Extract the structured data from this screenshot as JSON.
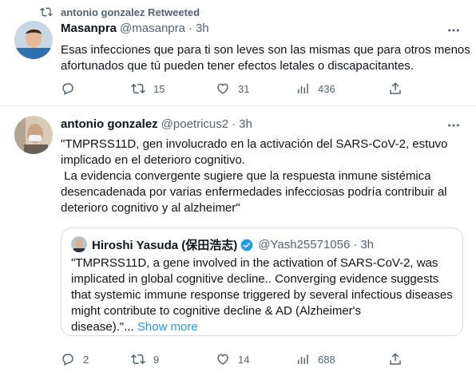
{
  "retweet": {
    "label": "antonio gonzalez Retweeted",
    "name": "Masanpra",
    "handle": "@masanpra",
    "dot": "·",
    "time": "3h",
    "text_lines": [
      "Esas infecciones que para ti son leves son las mismas que para otros menos",
      "afortunados que tú pueden tener efectos letales o discapacitantes."
    ],
    "replies": "",
    "retweets": "15",
    "likes": "31",
    "views": "436"
  },
  "tweet": {
    "name": "antonio gonzalez",
    "handle": "@poetricus2",
    "dot": "·",
    "time": "3h",
    "text_lines": [
      "\"TMPRSS11D, gen involucrado en la activación del SARS-CoV-2, estuvo",
      "implicado en el deterioro cognitivo.",
      " La evidencia convergente sugiere que la respuesta inmune sistémica",
      "desencadenada por varias enfermedades infecciosas podría contribuir al",
      "deterioro cognitivo y al alzheimer\""
    ],
    "replies": "2",
    "retweets": "9",
    "likes": "14",
    "views": "688"
  },
  "quote": {
    "name": "Hiroshi Yasuda (保田浩志)",
    "handle": "@Yash25571056",
    "dot": "·",
    "time": "3h",
    "text_lines": [
      "\"TMPRSS11D, a gene involved in the activation of SARS-CoV-2, was",
      "implicated in global cognitive decline.. Converging evidence suggests",
      "that systemic immune response triggered by several infectious diseases",
      "might contribute to cognitive decline & AD (Alzheimer's",
      "disease).\"..."
    ],
    "show_more": "Show more"
  },
  "colors": {
    "accent": "#1d9bf0",
    "muted": "#536471",
    "border": "#cfd9de",
    "verified": "#1d9bf0"
  }
}
